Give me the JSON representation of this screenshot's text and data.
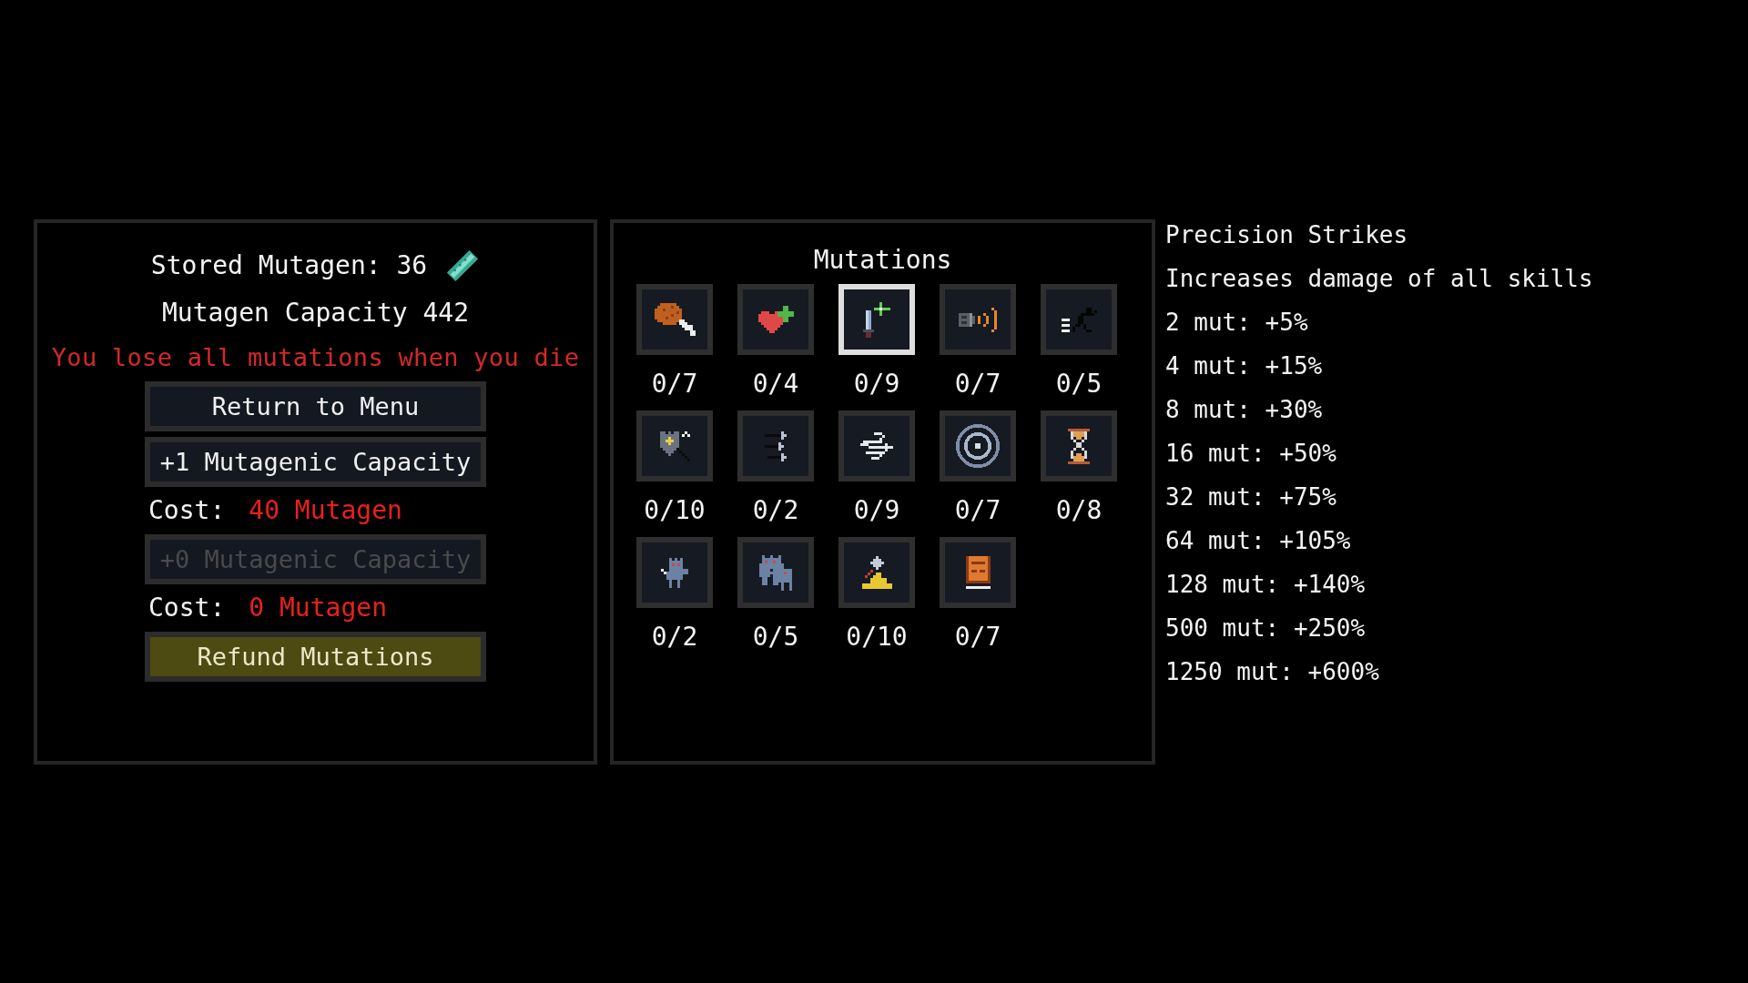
{
  "stash": {
    "stored": "Stored Mutagen: 36",
    "capacity": "Mutagen Capacity 442",
    "warning": "You lose all mutations when you die"
  },
  "actions": [
    {
      "kind": "button",
      "label": "Return to Menu",
      "disabled": false,
      "highlighted": false
    },
    {
      "kind": "button",
      "label": "+1 Mutagenic Capacity",
      "disabled": false,
      "highlighted": false
    },
    {
      "kind": "cost",
      "label": "Cost:",
      "value": "40 Mutagen"
    },
    {
      "kind": "button",
      "label": "+0 Mutagenic Capacity",
      "disabled": true,
      "highlighted": false
    },
    {
      "kind": "cost",
      "label": "Cost:",
      "value": "0 Mutagen"
    },
    {
      "kind": "button",
      "label": "Refund Mutations",
      "disabled": false,
      "highlighted": true
    }
  ],
  "mutations": {
    "title": "Mutations",
    "items": [
      {
        "count": "0/7",
        "selected": false
      },
      {
        "count": "0/4",
        "selected": false
      },
      {
        "count": "0/9",
        "selected": true
      },
      {
        "count": "0/7",
        "selected": false
      },
      {
        "count": "0/5",
        "selected": false
      },
      {
        "count": "0/10",
        "selected": false
      },
      {
        "count": "0/2",
        "selected": false
      },
      {
        "count": "0/9",
        "selected": false
      },
      {
        "count": "0/7",
        "selected": false
      },
      {
        "count": "0/8",
        "selected": false
      },
      {
        "count": "0/2",
        "selected": false
      },
      {
        "count": "0/5",
        "selected": false
      },
      {
        "count": "0/10",
        "selected": false
      },
      {
        "count": "0/7",
        "selected": false
      }
    ]
  },
  "details": {
    "title": "Precision Strikes",
    "description": "Increases damage of all skills",
    "tiers": [
      "2 mut: +5%",
      "4 mut: +15%",
      "8 mut: +30%",
      "16 mut: +50%",
      "32 mut: +75%",
      "64 mut: +105%",
      "128 mut: +140%",
      "500 mut: +250%",
      "1250 mut: +600%"
    ]
  }
}
